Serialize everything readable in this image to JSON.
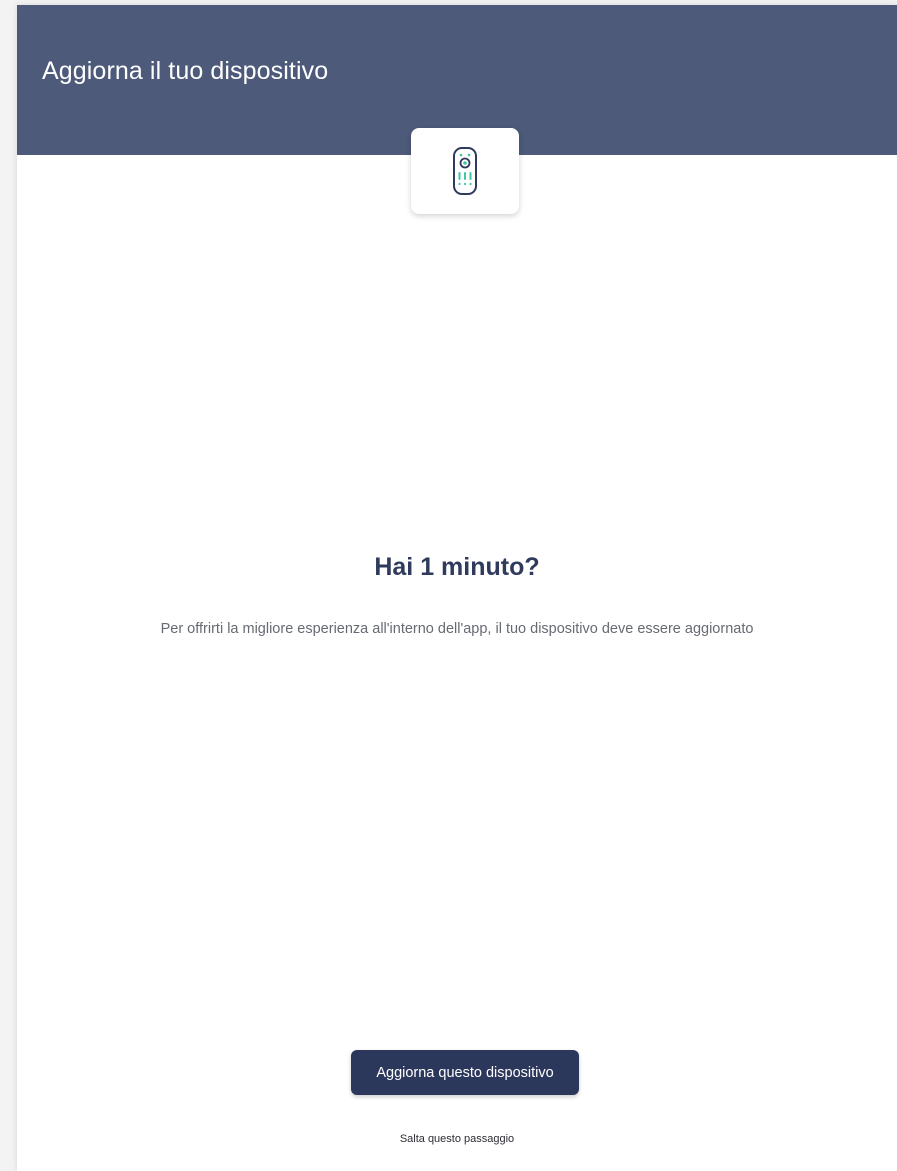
{
  "header": {
    "title": "Aggiorna il tuo dispositivo",
    "background_color": "#4d5a7a"
  },
  "device_card": {
    "icon": "remote-control-icon",
    "icon_outline_color": "#2f3a5c",
    "icon_accent_color": "#3ec7a0"
  },
  "content": {
    "title": "Hai 1 minuto?",
    "description": "Per offrirti la migliore esperienza all'interno dell'app, il tuo dispositivo deve essere aggiornato"
  },
  "actions": {
    "primary_label": "Aggiorna questo dispositivo",
    "primary_color": "#2c375c",
    "skip_label": "Salta questo passaggio"
  }
}
